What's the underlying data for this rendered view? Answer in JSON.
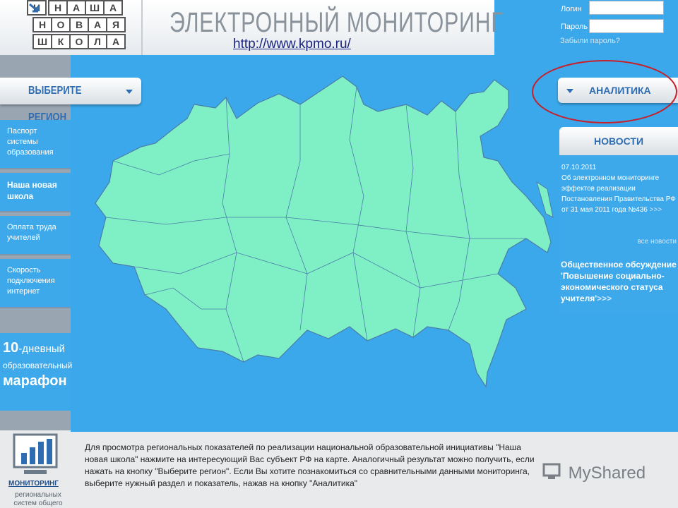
{
  "header": {
    "logo_rows": [
      [
        "Н",
        "А",
        "Ш",
        "А"
      ],
      [
        "Н",
        "О",
        "В",
        "А",
        "Я"
      ],
      [
        "Ш",
        "К",
        "О",
        "Л",
        "А"
      ]
    ],
    "title": "ЭЛЕКТРОННЫЙ МОНИТОРИНГ",
    "url": "http://www.kpmo.ru/"
  },
  "login": {
    "login_label": "Логин",
    "password_label": "Пароль",
    "forgot_link": "Забыли пароль?"
  },
  "nav": {
    "region_button": "ВЫБЕРИТЕ РЕГИОН",
    "items": [
      {
        "label": "Паспорт системы образования"
      },
      {
        "label": "Наша новая школа"
      },
      {
        "label": "Оплата труда учителей"
      },
      {
        "label": "Скорость подключения интернет"
      }
    ],
    "marathon_number": "10",
    "marathon_suffix": "-дневный",
    "marathon_line2": "образовательный",
    "marathon_line3": "марафон",
    "monitoring_label": "МОНИТОРИНГ",
    "monitoring_sub": "региональных систем общего"
  },
  "right": {
    "analytics_button": "АНАЛИТИКА",
    "news_header": "НОВОСТИ",
    "news_date": "07.10.2011",
    "news_text": "Об электронном мониторинге эффектов реализации Постановления Правительства РФ от 31 мая 2011 года №436",
    "more": ">>>",
    "all_news": "все новости",
    "discussion_title": "Общественное обсуждение",
    "discussion_text": "'Повышение социально-экономического статуса учителя'"
  },
  "bottom": {
    "info_text": "Для просмотра региональных показателей по реализации национальной образовательной инициативы \"Наша новая школа\" нажмите на интересующий Вас субъект РФ на карте. Аналогичный результат можно получить, если нажать на кнопку \"Выберите регион\". Если Вы хотите познакомиться со сравнительными данными мониторинга, выберите нужный раздел и показатель, нажав на кнопку \"Аналитика\"",
    "watermark": "MyShared"
  },
  "colors": {
    "background": "#3aa8ea",
    "map_fill": "#7ff0c6",
    "accent": "#2e6db1",
    "annotation": "#c8202a"
  }
}
